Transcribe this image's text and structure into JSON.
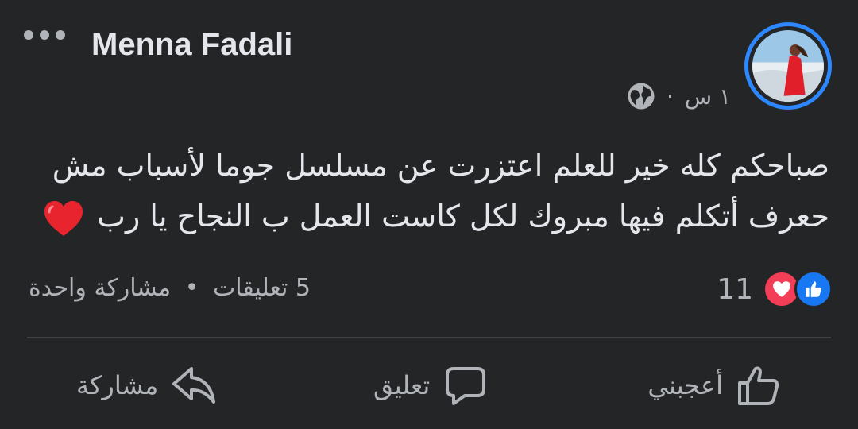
{
  "post": {
    "author": "Menna Fadali",
    "time": "١ س",
    "dot": "·",
    "text_line1": "صباحكم كله خير للعلم اعتزرت عن مسلسل جوما لأسباب مش",
    "text_line2": "حعرف أتكلم فيها مبروك لكل كاست العمل ب النجاح يا رب",
    "privacy_icon": "globe-icon",
    "emoji": "red-heart"
  },
  "stats": {
    "reaction_count": "11",
    "comments": "5 تعليقات",
    "separator": "•",
    "shares": "مشاركة واحدة"
  },
  "actions": {
    "like_label": "أعجبني",
    "comment_label": "تعليق",
    "share_label": "مشاركة"
  },
  "colors": {
    "background": "#242526",
    "accent": "#2d88ff",
    "like_blue": "#1877f2",
    "love_red": "#f33e58",
    "secondary_text": "#b0b3b8"
  }
}
